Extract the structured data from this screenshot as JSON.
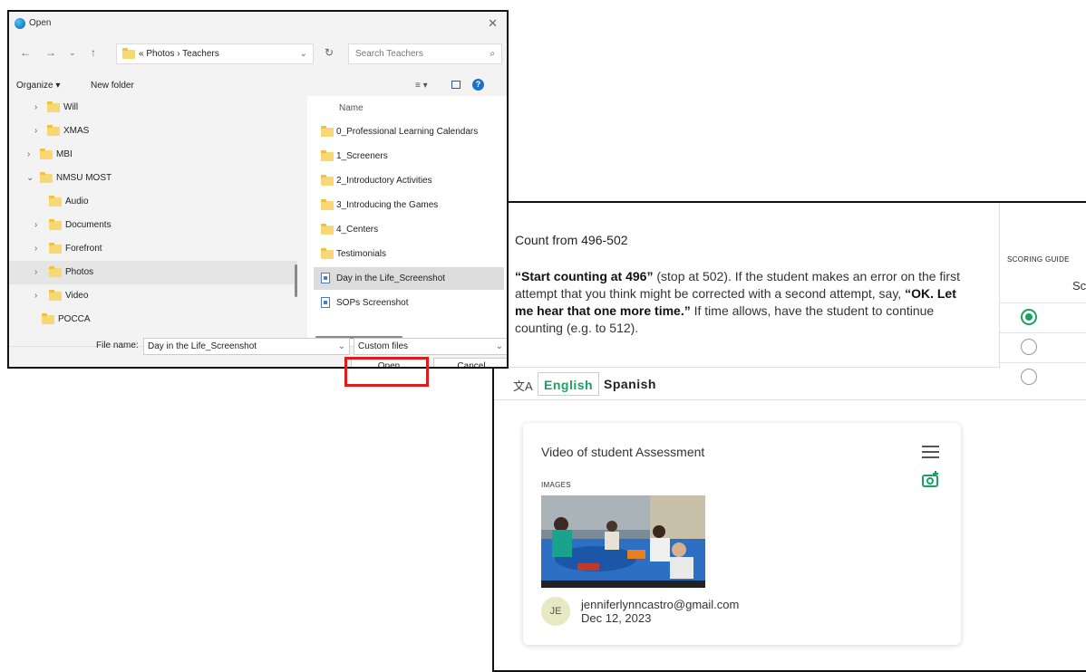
{
  "dialog": {
    "title": "Open",
    "breadcrumb": "« Photos › Teachers",
    "search_placeholder": "Search Teachers",
    "organize_label": "Organize ▾",
    "new_folder_label": "New folder",
    "tree": [
      {
        "label": "Will",
        "expandable": true
      },
      {
        "label": "XMAS",
        "expandable": true
      },
      {
        "label": "MBI",
        "expandable": true
      },
      {
        "label": "NMSU MOST",
        "expanded": true
      },
      {
        "label": "Audio",
        "expandable": false
      },
      {
        "label": "Documents",
        "expandable": true
      },
      {
        "label": "Forefront",
        "expandable": true
      },
      {
        "label": "Photos",
        "expandable": true,
        "selected": true
      },
      {
        "label": "Video",
        "expandable": true
      },
      {
        "label": "POCCA",
        "expandable": false
      }
    ],
    "column_name": "Name",
    "files": [
      {
        "label": "0_Professional Learning Calendars",
        "type": "folder"
      },
      {
        "label": "1_Screeners",
        "type": "folder"
      },
      {
        "label": "2_Introductory Activities",
        "type": "folder"
      },
      {
        "label": "3_Introducing the Games",
        "type": "folder"
      },
      {
        "label": "4_Centers",
        "type": "folder"
      },
      {
        "label": "Testimonials",
        "type": "folder"
      },
      {
        "label": "Day in the Life_Screenshot",
        "type": "image",
        "selected": true
      },
      {
        "label": "SOPs Screenshot",
        "type": "image"
      }
    ],
    "file_name_label": "File name:",
    "file_name_value": "Day in the Life_Screenshot",
    "file_type": "Custom files",
    "open_label": "Open",
    "cancel_label": "Cancel",
    "highlight_color": "#e01b1b"
  },
  "assessment": {
    "title": "Count from 496-502",
    "instruction_bold_1": "“Start counting at 496”",
    "instruction_1": " (stop at 502). If the student makes an error on the first attempt that you think might be corrected with a second attempt, say, ",
    "instruction_bold_2": "“OK. Let me hear that one more time.”",
    "instruction_2": " If time allows, have the student to continue counting (e.g. to 512).",
    "scoring_label": "SCORING GUIDE",
    "scoring_header": "Sc",
    "languages": [
      "English",
      "Spanish"
    ],
    "active_language": "English",
    "accent_color": "#1aa260",
    "card": {
      "title": "Video of student Assessment",
      "images_label": "IMAGES",
      "avatar_initials": "JE",
      "author_email": "jenniferlynncastro@gmail.com",
      "date": "Dec 12, 2023"
    }
  }
}
